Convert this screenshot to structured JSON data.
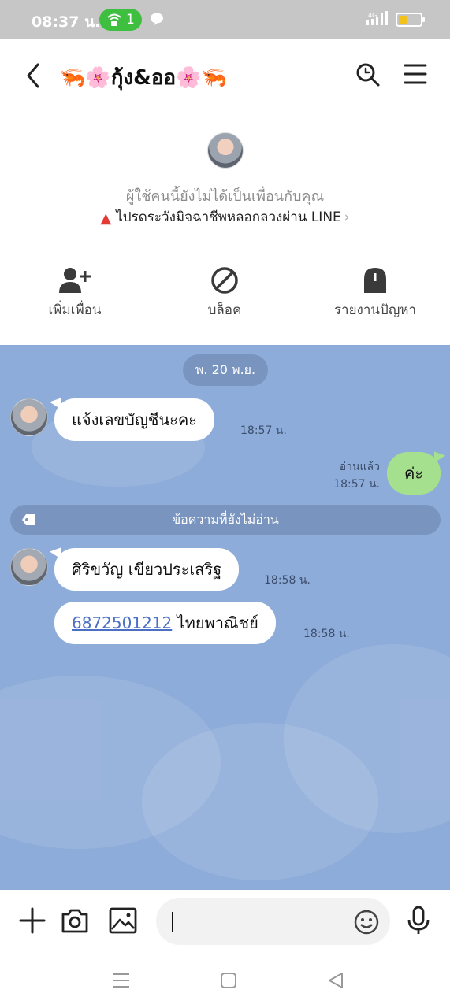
{
  "status_bar": {
    "time": "08:37 น.",
    "hotspot_count": "1"
  },
  "header": {
    "title": "🦐🌸กุ้ง&ออ🌸🦐"
  },
  "profile": {
    "not_friend_text": "ผู้ใช้คนนี้ยังไม่ได้เป็นเพื่อนกับคุณ",
    "warning_text": "ไปรดระวังมิจฉาชีพหลอกลวงผ่าน LINE"
  },
  "actions": [
    {
      "label": "เพิ่มเพื่อน",
      "icon": "add-friend-icon"
    },
    {
      "label": "บล็อค",
      "icon": "block-icon"
    },
    {
      "label": "รายงานปัญหา",
      "icon": "report-icon"
    }
  ],
  "chat": {
    "date": "พ. 20 พ.ย.",
    "messages": {
      "m1_text": "แจ้งเลขบัญชีนะคะ",
      "m1_time": "18:57 น.",
      "m2_text": "ค่ะ",
      "m2_read": "อ่านแล้ว",
      "m2_time": "18:57 น.",
      "m3_text": "ศิริขวัญ เขียวประเสริฐ",
      "m3_time": "18:58 น.",
      "m4_link": "6872501212",
      "m4_text": " ไทยพาณิชย์",
      "m4_time": "18:58 น."
    },
    "unread_label": "ข้อความที่ยังไม่อ่าน"
  },
  "input_bar": {
    "message_value": ""
  },
  "colors": {
    "chat_bg": "#8eacd9",
    "my_bubble": "#a5e08e",
    "status_green": "#3fbf3f",
    "warning_red": "#e53935"
  }
}
